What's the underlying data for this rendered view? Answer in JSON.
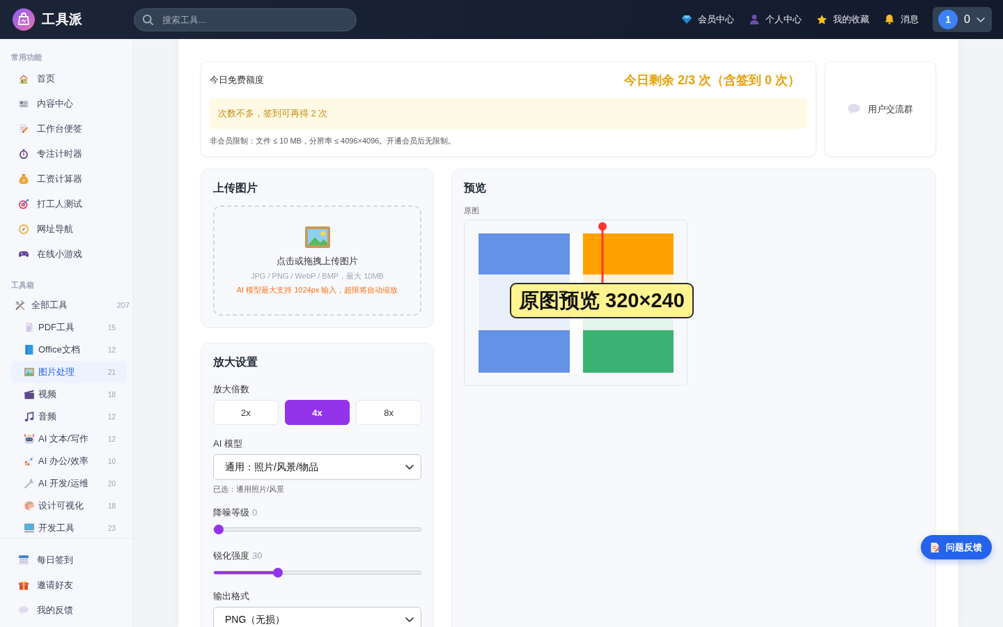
{
  "header": {
    "brand": "工具派",
    "search": {
      "placeholder": "搜索工具..."
    },
    "nav": [
      {
        "label": "会员中心"
      },
      {
        "label": "个人中心"
      },
      {
        "label": "我的收藏"
      },
      {
        "label": "消息"
      }
    ],
    "account": {
      "avatar": "1",
      "count": "0"
    }
  },
  "sidebar": {
    "sections": [
      {
        "title": "常用功能",
        "items": [
          {
            "label": "首页",
            "selected": false
          },
          {
            "label": "内容中心",
            "selected": false
          },
          {
            "label": "工作台便签",
            "selected": false
          },
          {
            "label": "专注计时器",
            "selected": false
          },
          {
            "label": "工资计算器",
            "selected": false
          },
          {
            "label": "打工人测试",
            "selected": false
          },
          {
            "label": "网址导航",
            "selected": false
          },
          {
            "label": "在线小游戏",
            "selected": false
          }
        ]
      },
      {
        "title": "工具箱",
        "items": [
          {
            "label": "全部工具",
            "count": "207",
            "selected": false,
            "children": [
              {
                "label": "PDF工具",
                "count": "15",
                "selected": false
              },
              {
                "label": "Office文档",
                "count": "12",
                "selected": false
              },
              {
                "label": "图片处理",
                "count": "21",
                "selected": true
              },
              {
                "label": "视频",
                "count": "18",
                "selected": false
              },
              {
                "label": "音频",
                "count": "12",
                "selected": false
              },
              {
                "label": "AI 文本/写作",
                "count": "12",
                "selected": false
              },
              {
                "label": "AI 办公/效率",
                "count": "10",
                "selected": false
              },
              {
                "label": "AI 开发/运维",
                "count": "20",
                "selected": false
              },
              {
                "label": "设计可视化",
                "count": "18",
                "selected": false
              },
              {
                "label": "开发工具",
                "count": "23",
                "selected": false
              }
            ]
          }
        ]
      }
    ],
    "footer_items": [
      {
        "label": "每日签到",
        "selected": false
      },
      {
        "label": "邀请好友",
        "selected": false
      },
      {
        "label": "我的反馈",
        "selected": false
      }
    ]
  },
  "quota": {
    "title": "今日免费额度",
    "remaining": "今日剩余 2/3 次（含签到 0 次）",
    "notice": "次数不多，签到可再得 2 次",
    "limits": "非会员限制：文件 ≤ 10 MB，分辨率 ≤ 4096×4096。开通会员后无限制。"
  },
  "community": {
    "label": "用户交流群"
  },
  "upload": {
    "title": "上传图片",
    "prompt": "点击或拖拽上传图片",
    "formats": "JPG / PNG / WebP / BMP，最大 10MB",
    "warning": "AI 模型最大支持 1024px 输入，超限将自动缩放"
  },
  "settings": {
    "title": "放大设置",
    "scale": {
      "label": "放大倍数",
      "options": [
        {
          "label": "2x",
          "selected": false
        },
        {
          "label": "4x",
          "selected": true
        },
        {
          "label": "8x",
          "selected": false
        }
      ]
    },
    "model": {
      "label": "AI 模型",
      "value": "通用：照片/风景/物品",
      "hint": "已选：通用照片/风景"
    },
    "denoise": {
      "label": "降噪等级",
      "reading": "0",
      "level": 0
    },
    "sharpen": {
      "label": "锐化强度",
      "reading": "30",
      "level": 0.3
    },
    "format": {
      "label": "输出格式",
      "value": "PNG（无损）"
    }
  },
  "preview": {
    "title": "预览",
    "caption": "原图",
    "annotation": "原图预览 320×240"
  },
  "feedback": {
    "label": "问题反馈"
  }
}
